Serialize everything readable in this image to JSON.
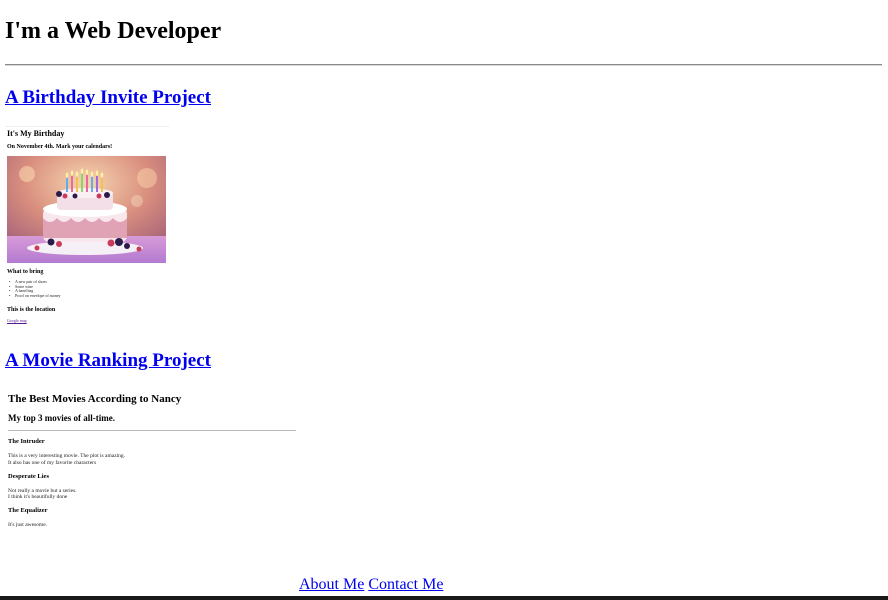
{
  "header": {
    "title": "I'm a Web Developer"
  },
  "projects": [
    {
      "link": "A Birthday Invite Project",
      "preview": {
        "heading": "It's My Birthday",
        "subheading": "On November 4th. Mark your calendars!",
        "bring_heading": "What to bring",
        "bring_items": [
          "A new pair of shoes",
          "Some wine",
          "A hand bag",
          "Proof on envelope of money"
        ],
        "location_heading": "This is the location",
        "location_link": "Google map"
      }
    },
    {
      "link": "A Movie Ranking Project",
      "preview": {
        "title": "The Best Movies According to Nancy",
        "subtitle": "My top 3 movies of all-time.",
        "movies": [
          {
            "name": "The Intruder",
            "lines": [
              "This is a very interesting movie. The plot is amazing.",
              "It also has one of my favorite characters"
            ]
          },
          {
            "name": "Desperate Lies",
            "lines": [
              "Not really a movie but a series.",
              "I think it's beautifully done"
            ]
          },
          {
            "name": "The Equalizer",
            "lines": [
              "It's just awesome."
            ]
          }
        ]
      }
    }
  ],
  "footer": {
    "about": "About Me",
    "contact": "Contact Me"
  }
}
